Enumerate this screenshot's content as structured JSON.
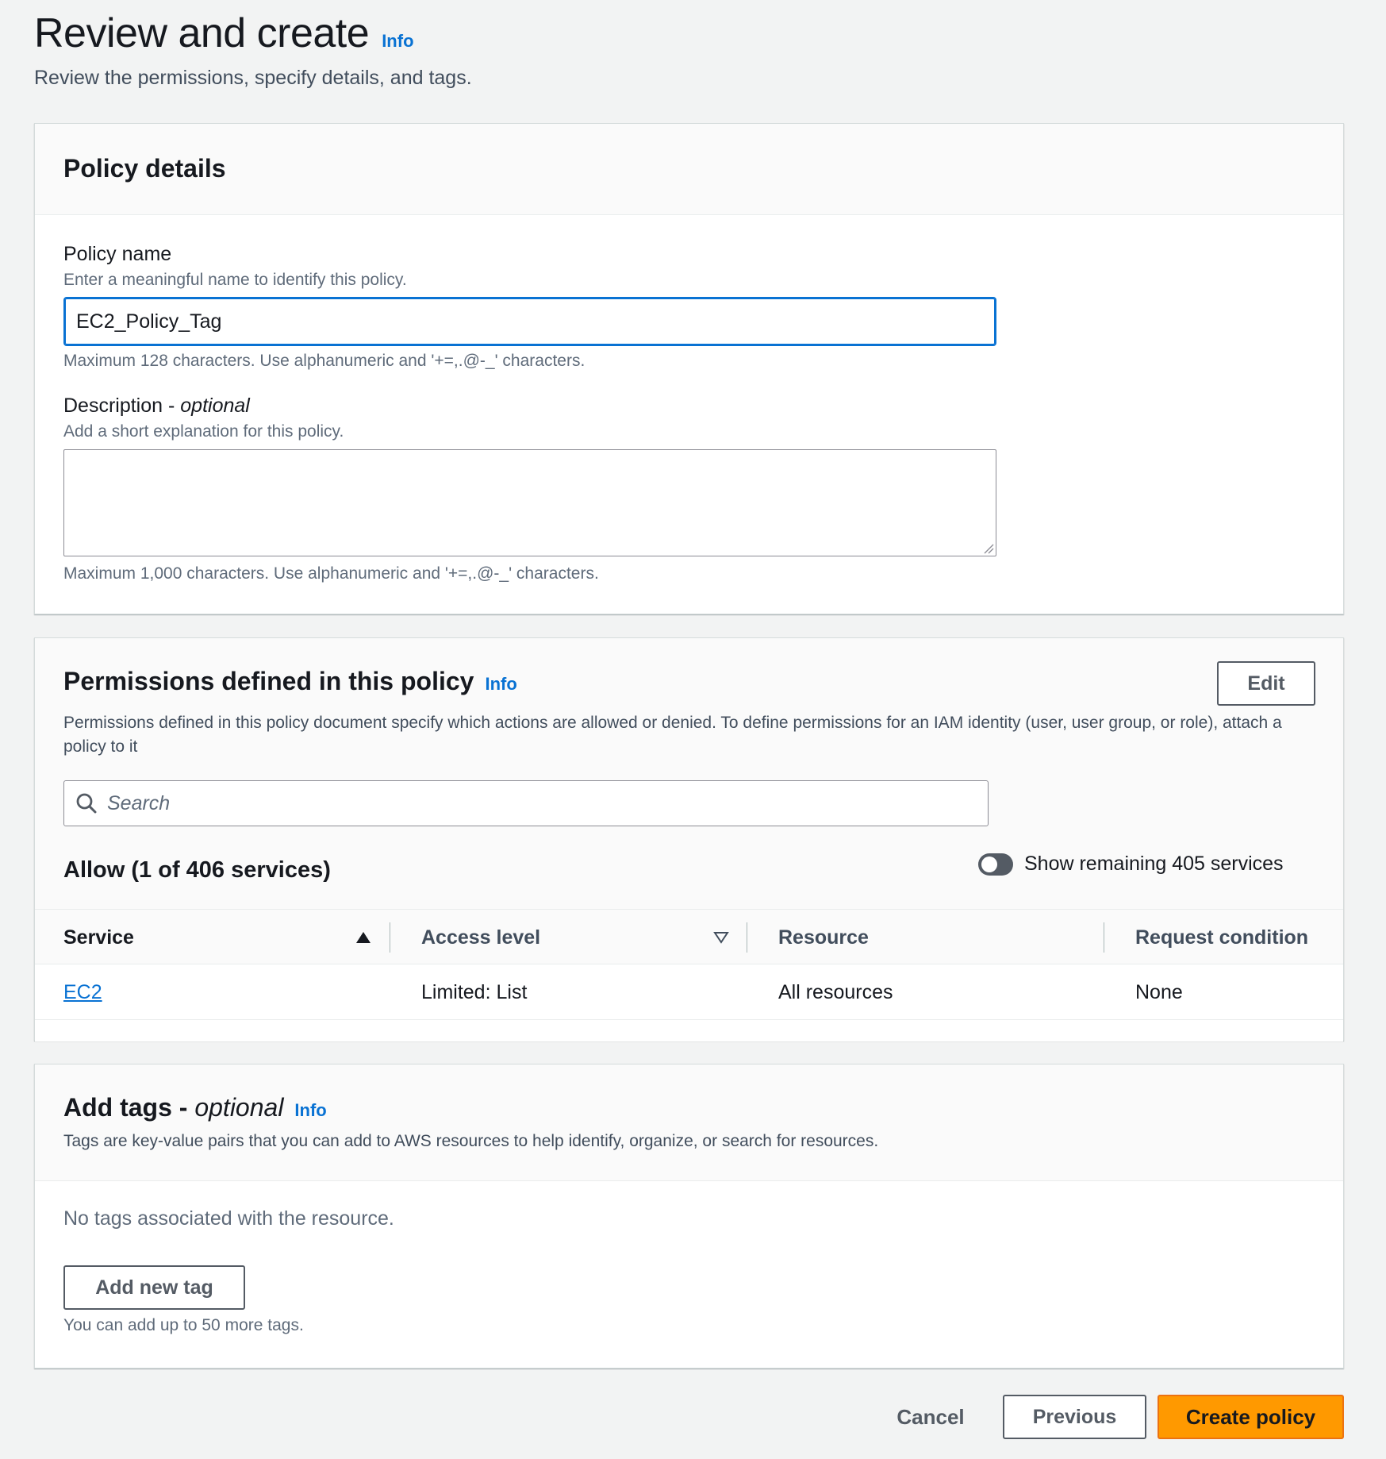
{
  "header": {
    "title": "Review and create",
    "info": "Info",
    "subtitle": "Review the permissions, specify details, and tags."
  },
  "policy_details": {
    "title": "Policy details",
    "name_label": "Policy name",
    "name_desc": "Enter a meaningful name to identify this policy.",
    "name_value": "EC2_Policy_Tag",
    "name_hint": "Maximum 128 characters. Use alphanumeric and '+=,.@-_' characters.",
    "desc_label": "Description - ",
    "desc_label_optional": "optional",
    "desc_desc": "Add a short explanation for this policy.",
    "desc_value": "",
    "desc_hint": "Maximum 1,000 characters. Use alphanumeric and '+=,.@-_' characters."
  },
  "permissions": {
    "title": "Permissions defined in this policy",
    "info": "Info",
    "edit_label": "Edit",
    "description": "Permissions defined in this policy document specify which actions are allowed or denied. To define permissions for an IAM identity (user, user group, or role), attach a policy to it",
    "search_placeholder": "Search",
    "allow_title": "Allow (1 of 406 services)",
    "toggle_label": "Show remaining 405 services",
    "toggle_on": false,
    "columns": [
      "Service",
      "Access level",
      "Resource",
      "Request condition"
    ],
    "rows": [
      {
        "service": "EC2",
        "access_level": "Limited: List",
        "resource": "All resources",
        "request_condition": "None"
      }
    ]
  },
  "tags": {
    "title": "Add tags - ",
    "title_optional": "optional",
    "info": "Info",
    "description": "Tags are key-value pairs that you can add to AWS resources to help identify, organize, or search for resources.",
    "empty_text": "No tags associated with the resource.",
    "add_label": "Add new tag",
    "hint": "You can add up to 50 more tags."
  },
  "footer": {
    "cancel_label": "Cancel",
    "previous_label": "Previous",
    "create_label": "Create policy"
  },
  "colors": {
    "accent": "#0972d3",
    "primary_button": "#ff9900",
    "background": "#f2f3f3"
  }
}
